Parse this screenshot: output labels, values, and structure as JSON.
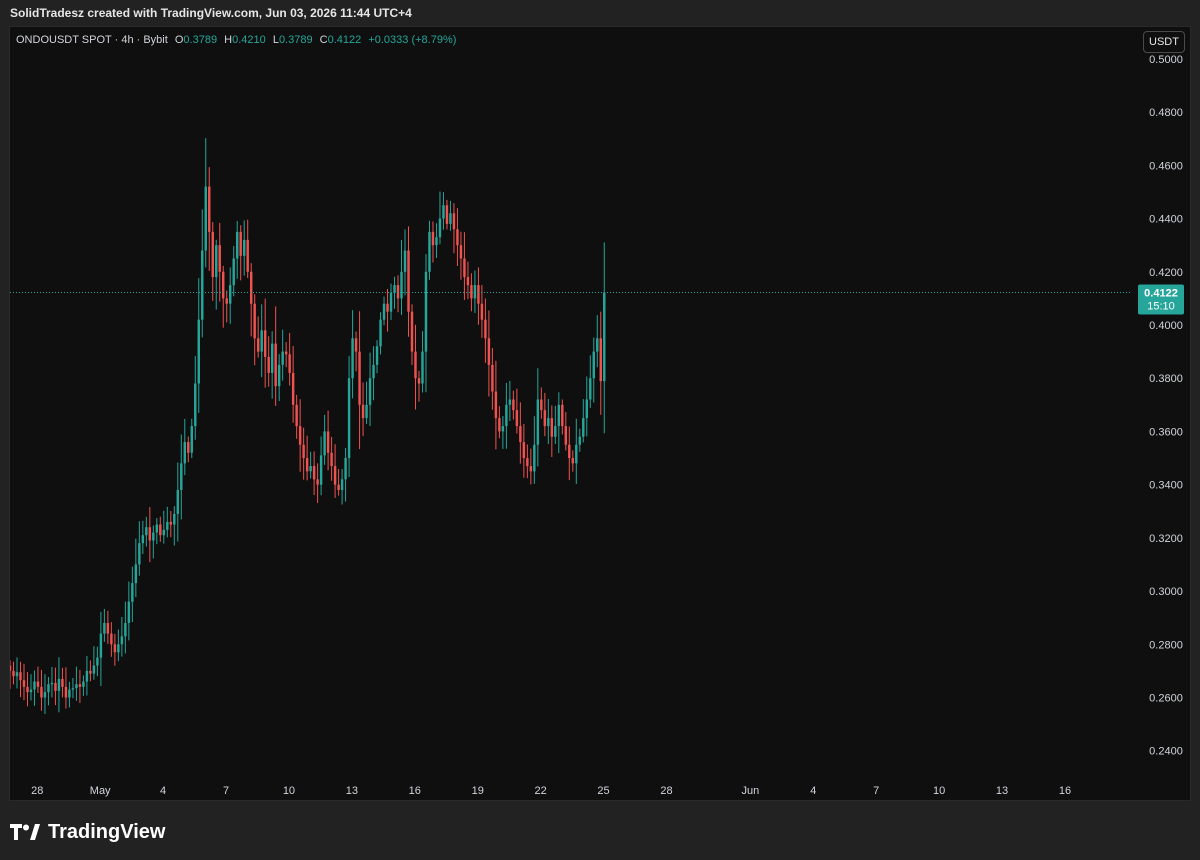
{
  "header": {
    "attribution": "SolidTradesz created with TradingView.com, Jun 03, 2026 11:44 UTC+4"
  },
  "legend": {
    "symbol": "ONDOUSDT SPOT · 4h · Bybit",
    "o_label": "O",
    "o_value": "0.3789",
    "h_label": "H",
    "h_value": "0.4210",
    "l_label": "L",
    "l_value": "0.3789",
    "c_label": "C",
    "c_value": "0.4122",
    "change": "+0.0333 (+8.79%)"
  },
  "currency_button": "USDT",
  "price_tag": {
    "price": "0.4122",
    "countdown": "15:10"
  },
  "brand": {
    "name": "TradingView"
  },
  "colors": {
    "up": "#26a69a",
    "down": "#ef5350",
    "background": "#0f0f0f",
    "frame": "#222222",
    "axis_text": "#d1d4dc"
  },
  "chart_data": {
    "type": "candlestick",
    "timeframe": "4h",
    "last_price": 0.4122,
    "ylim": [
      0.232,
      0.512
    ],
    "y_ticks": [
      "0.2400",
      "0.2600",
      "0.2800",
      "0.3000",
      "0.3200",
      "0.3400",
      "0.3600",
      "0.3800",
      "0.4000",
      "0.4200",
      "0.4400",
      "0.4600",
      "0.4800",
      "0.5000"
    ],
    "x_ticks": [
      {
        "label": "28",
        "day": 0
      },
      {
        "label": "May",
        "day": 3
      },
      {
        "label": "4",
        "day": 6
      },
      {
        "label": "7",
        "day": 9
      },
      {
        "label": "10",
        "day": 12
      },
      {
        "label": "13",
        "day": 15
      },
      {
        "label": "16",
        "day": 18
      },
      {
        "label": "19",
        "day": 21
      },
      {
        "label": "22",
        "day": 24
      },
      {
        "label": "25",
        "day": 27
      },
      {
        "label": "28",
        "day": 30
      },
      {
        "label": "Jun",
        "day": 34
      },
      {
        "label": "4",
        "day": 37
      },
      {
        "label": "7",
        "day": 40
      },
      {
        "label": "10",
        "day": 43
      },
      {
        "label": "13",
        "day": 46
      },
      {
        "label": "16",
        "day": 49
      }
    ],
    "x_range_days": [
      -1.3,
      52.1
    ],
    "first_candle_day": -1.3,
    "candles_per_day": 6,
    "closes": [
      0.27,
      0.268,
      0.2695,
      0.2665,
      0.264,
      0.262,
      0.263,
      0.266,
      0.264,
      0.26,
      0.262,
      0.265,
      0.2655,
      0.2625,
      0.267,
      0.264,
      0.26,
      0.263,
      0.2635,
      0.265,
      0.264,
      0.266,
      0.27,
      0.269,
      0.272,
      0.275,
      0.284,
      0.288,
      0.284,
      0.28,
      0.277,
      0.28,
      0.283,
      0.288,
      0.296,
      0.303,
      0.31,
      0.318,
      0.321,
      0.324,
      0.319,
      0.322,
      0.325,
      0.321,
      0.323,
      0.326,
      0.325,
      0.329,
      0.338,
      0.348,
      0.356,
      0.352,
      0.362,
      0.378,
      0.402,
      0.428,
      0.452,
      0.435,
      0.418,
      0.43,
      0.42,
      0.41,
      0.408,
      0.415,
      0.425,
      0.435,
      0.426,
      0.432,
      0.42,
      0.408,
      0.395,
      0.39,
      0.398,
      0.388,
      0.382,
      0.393,
      0.377,
      0.385,
      0.39,
      0.389,
      0.382,
      0.37,
      0.362,
      0.355,
      0.35,
      0.345,
      0.347,
      0.342,
      0.34,
      0.351,
      0.36,
      0.352,
      0.347,
      0.34,
      0.338,
      0.342,
      0.35,
      0.38,
      0.395,
      0.39,
      0.37,
      0.365,
      0.37,
      0.38,
      0.385,
      0.392,
      0.402,
      0.408,
      0.405,
      0.412,
      0.415,
      0.41,
      0.42,
      0.428,
      0.405,
      0.39,
      0.38,
      0.378,
      0.39,
      0.42,
      0.435,
      0.43,
      0.433,
      0.44,
      0.445,
      0.438,
      0.442,
      0.436,
      0.43,
      0.425,
      0.418,
      0.415,
      0.41,
      0.415,
      0.408,
      0.402,
      0.395,
      0.385,
      0.375,
      0.365,
      0.36,
      0.362,
      0.37,
      0.372,
      0.368,
      0.362,
      0.356,
      0.35,
      0.347,
      0.345,
      0.355,
      0.372,
      0.368,
      0.362,
      0.365,
      0.358,
      0.362,
      0.37,
      0.362,
      0.355,
      0.35,
      0.348,
      0.355,
      0.358,
      0.365,
      0.372,
      0.38,
      0.39,
      0.395,
      0.3789,
      0.4122
    ]
  }
}
